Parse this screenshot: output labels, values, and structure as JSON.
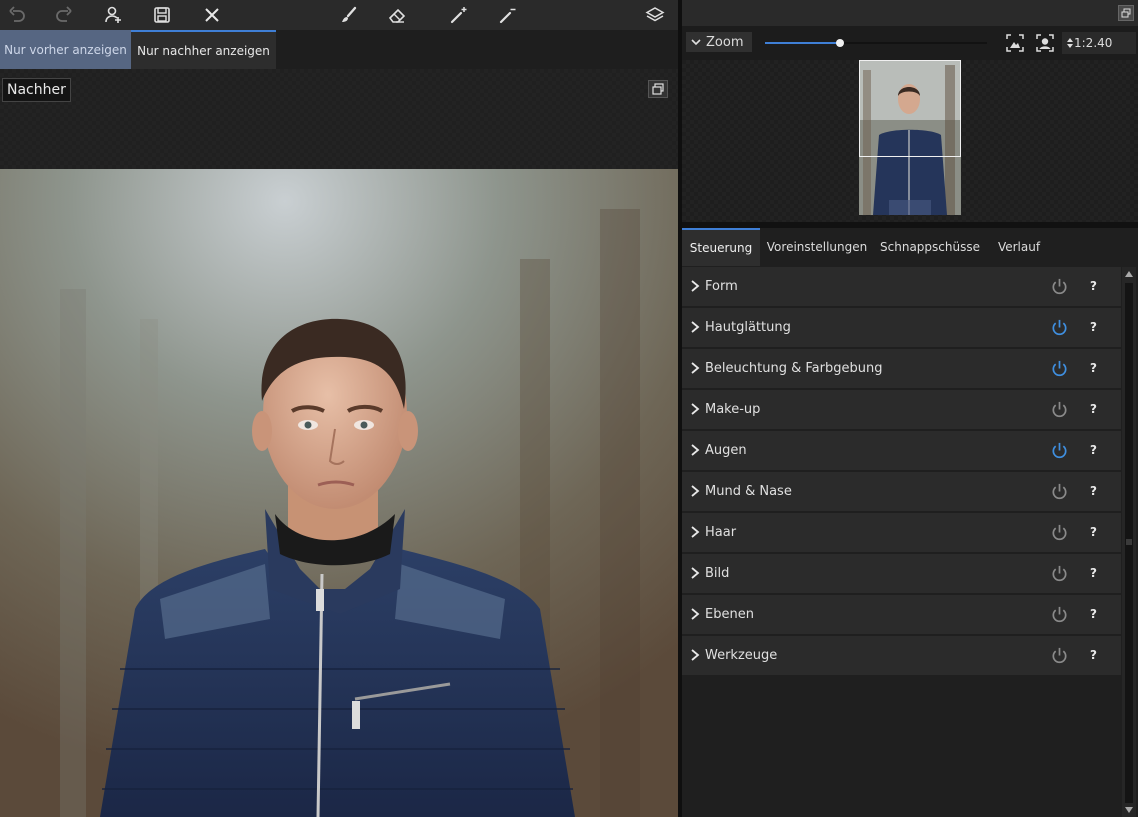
{
  "toolbar": {
    "tools": [
      "undo-icon",
      "redo-icon",
      "add-person-icon",
      "save-icon",
      "close-icon",
      "brush-icon",
      "eraser-icon",
      "magic-wand-plus-icon",
      "magic-wand-minus-icon",
      "layers-icon"
    ]
  },
  "view_tabs": {
    "before": "Nur vorher anzeigen",
    "after": "Nur nachher anzeigen"
  },
  "canvas": {
    "label": "Nachher"
  },
  "navigator": {
    "zoom_label": "Zoom",
    "zoom_ratio": "1:2.40",
    "zoom_slider_fraction": 0.34
  },
  "panel_tabs": [
    "Steuerung",
    "Voreinstellungen",
    "Schnappschüsse",
    "Verlauf"
  ],
  "sections": [
    {
      "label": "Form",
      "enabled": false,
      "help": "?"
    },
    {
      "label": "Hautglättung",
      "enabled": true,
      "help": "?"
    },
    {
      "label": "Beleuchtung & Farbgebung",
      "enabled": true,
      "help": "?"
    },
    {
      "label": "Make-up",
      "enabled": false,
      "help": "?"
    },
    {
      "label": "Augen",
      "enabled": true,
      "help": "?"
    },
    {
      "label": "Mund & Nase",
      "enabled": false,
      "help": "?"
    },
    {
      "label": "Haar",
      "enabled": false,
      "help": "?"
    },
    {
      "label": "Bild",
      "enabled": false,
      "help": "?"
    },
    {
      "label": "Ebenen",
      "enabled": false,
      "help": "?"
    },
    {
      "label": "Werkzeuge",
      "enabled": false,
      "help": "?"
    }
  ],
  "colors": {
    "accent": "#3f7fd6",
    "power_on": "#3f8fe0",
    "power_off": "#8a8a8a"
  }
}
